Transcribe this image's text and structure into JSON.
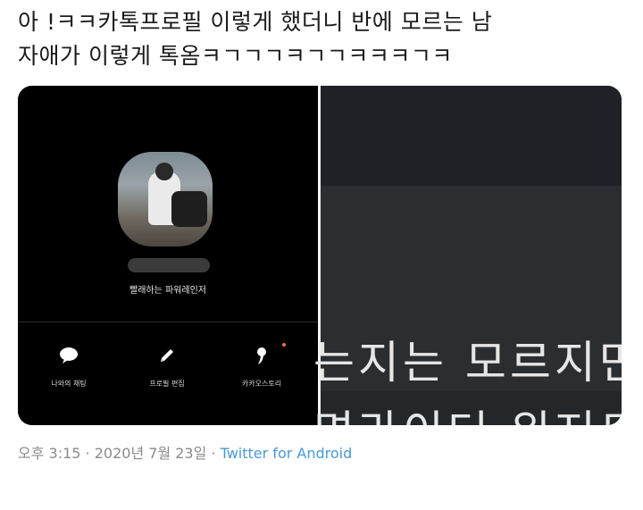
{
  "tweet": {
    "text": "아       !ㅋㅋ카톡프로필 이렇게 했더니 반에 모르는 남\n자애가 이렇게 톡옴ㅋㄱㄱㄱㅋㄱㄱㅋㅋㅋㄱㅋ"
  },
  "kakao_profile": {
    "status_message": "빨래하는 파워레인저",
    "actions": [
      {
        "label": "나와의 채팅",
        "icon": "chat-bubble-icon"
      },
      {
        "label": "프로필 편집",
        "icon": "pencil-icon"
      },
      {
        "label": "카카오스토리",
        "icon": "kakaostory-icon"
      }
    ],
    "new_dot_color": "#ff6a3d"
  },
  "video_subtitle": {
    "line1": "는지는 모르지만",
    "line2": "면라이더 위저드"
  },
  "meta": {
    "time": "오후 3:15",
    "separator1": " · ",
    "date": "2020년 7월 23일",
    "separator2": " · ",
    "source": "Twitter for Android"
  },
  "colors": {
    "source_link": "#4a98d8",
    "meta_text": "#8a8a8a"
  }
}
